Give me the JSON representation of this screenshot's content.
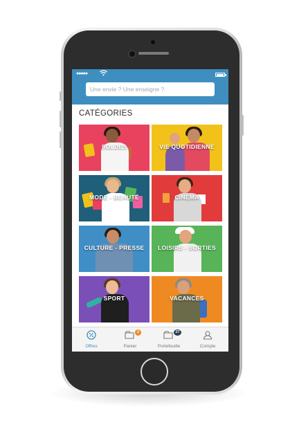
{
  "search": {
    "placeholder": "Une envie ? Une enseigne ?"
  },
  "categories_title": "CATÉGORIES",
  "categories": [
    {
      "label": "SOLDES",
      "color": "#e8425f"
    },
    {
      "label": "VIE QUOTIDIENNE",
      "color": "#f2c21b"
    },
    {
      "label": "MODE - BEAUTÉ",
      "color": "#1f5f7a"
    },
    {
      "label": "CINÉMA",
      "color": "#e23b3b"
    },
    {
      "label": "CULTURE - PRESSE",
      "color": "#3f8fc6"
    },
    {
      "label": "LOISIRS - SORTIES",
      "color": "#58b458"
    },
    {
      "label": "SPORT",
      "color": "#7b4fb8"
    },
    {
      "label": "VACANCES",
      "color": "#ef8a22"
    }
  ],
  "tabs": [
    {
      "label": "Offres",
      "icon": "offers-icon",
      "active": true
    },
    {
      "label": "Panier",
      "icon": "cart-icon",
      "badge": "2",
      "badge_color": "#ef8a22"
    },
    {
      "label": "Portefeuille",
      "icon": "wallet-icon",
      "badge": "27",
      "badge_color": "#2d3e55"
    },
    {
      "label": "Compte",
      "icon": "account-icon"
    }
  ],
  "colors": {
    "accent": "#3e8fbf"
  }
}
